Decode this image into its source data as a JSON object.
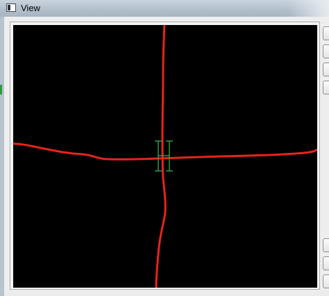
{
  "window": {
    "title": "View",
    "icon": "app-window-icon"
  },
  "canvas": {
    "background_color": "#000000",
    "stroke_color": "#e8241b",
    "cursor_icon": "ibeam-cursor-icon",
    "cursor_color": "#2fa64a"
  },
  "side_buttons": {
    "count_top": 4,
    "count_bottom": 3
  }
}
